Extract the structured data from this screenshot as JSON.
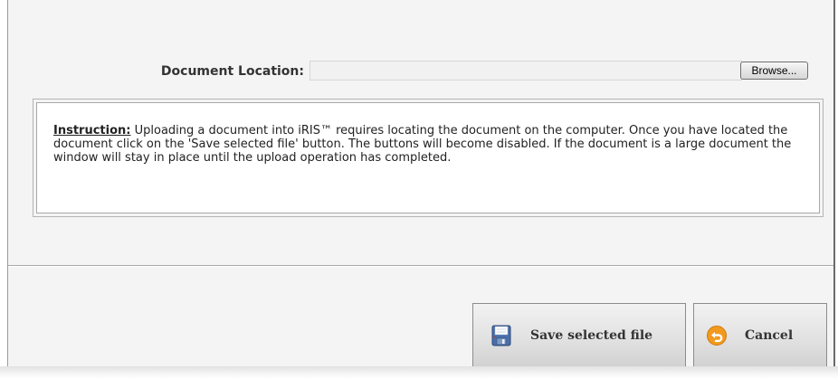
{
  "form": {
    "location_label": "Document Location:",
    "location_value": "",
    "browse_label": "Browse..."
  },
  "instruction": {
    "lead": "Instruction:",
    "text": " Uploading a document into iRIS™ requires locating the document on the computer. Once you have located the document click on the 'Save selected file' button. The buttons will become disabled. If the document is a large document the window will stay in place until the upload operation has completed."
  },
  "actions": {
    "save_label": "Save selected file",
    "save_icon": "floppy-disk-icon",
    "cancel_label": "Cancel",
    "cancel_icon": "undo-arrow-icon"
  },
  "colors": {
    "cancel_icon": "#f29a1f",
    "save_icon": "#4a6fa8"
  }
}
